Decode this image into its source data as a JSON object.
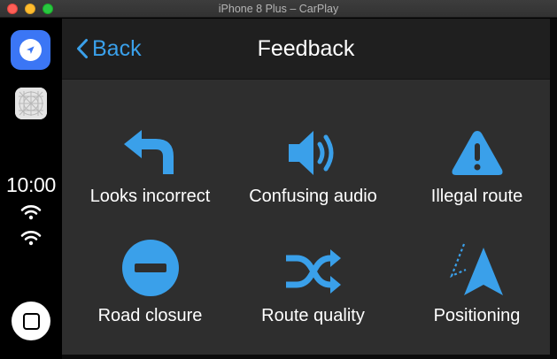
{
  "window": {
    "title": "iPhone 8 Plus – CarPlay"
  },
  "dock": {
    "time": "10:00",
    "apps": [
      {
        "name": "maps-app",
        "icon": "compass-icon",
        "color": "#3b76f5"
      },
      {
        "name": "grid-app",
        "icon": "grid-icon"
      }
    ]
  },
  "navbar": {
    "back_label": "Back",
    "title": "Feedback"
  },
  "accent": "#3aa0ea",
  "items": [
    {
      "label": "Looks incorrect",
      "icon": "turn-left-arrow-icon"
    },
    {
      "label": "Confusing audio",
      "icon": "speaker-icon"
    },
    {
      "label": "Illegal route",
      "icon": "warning-triangle-icon"
    },
    {
      "label": "Road closure",
      "icon": "no-entry-icon"
    },
    {
      "label": "Route quality",
      "icon": "shuffle-arrows-icon"
    },
    {
      "label": "Positioning",
      "icon": "location-arrow-icon"
    }
  ]
}
